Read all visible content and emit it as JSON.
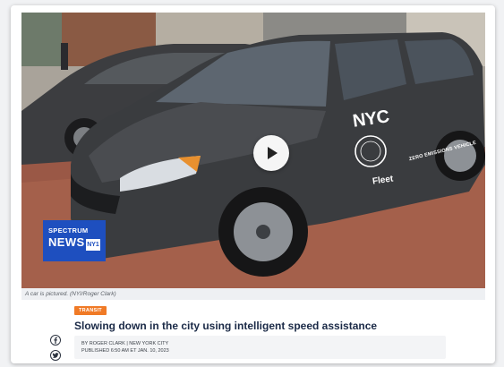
{
  "caption": "A car is pictured. (NYI/Roger Clark)",
  "badge": {
    "line1": "SPECTRUM",
    "line2": "NEWS",
    "mark": "NY1"
  },
  "door": {
    "nyc": "NYC",
    "fleet": "Fleet",
    "zero": "ZERO EMISSIONS VEHICLE"
  },
  "article": {
    "tag": "TRANSIT",
    "headline": "Slowing down in the city using intelligent speed assistance",
    "byline": "BY ROGER CLARK | NEW YORK CITY",
    "published": "PUBLISHED 6:50 AM ET JAN. 10, 2023"
  },
  "icons": {
    "play": "play-icon",
    "facebook": "facebook-icon",
    "twitter": "twitter-icon"
  },
  "colors": {
    "tag": "#f07a26",
    "headline": "#1b2a47",
    "badge": "#1e4fbf"
  }
}
